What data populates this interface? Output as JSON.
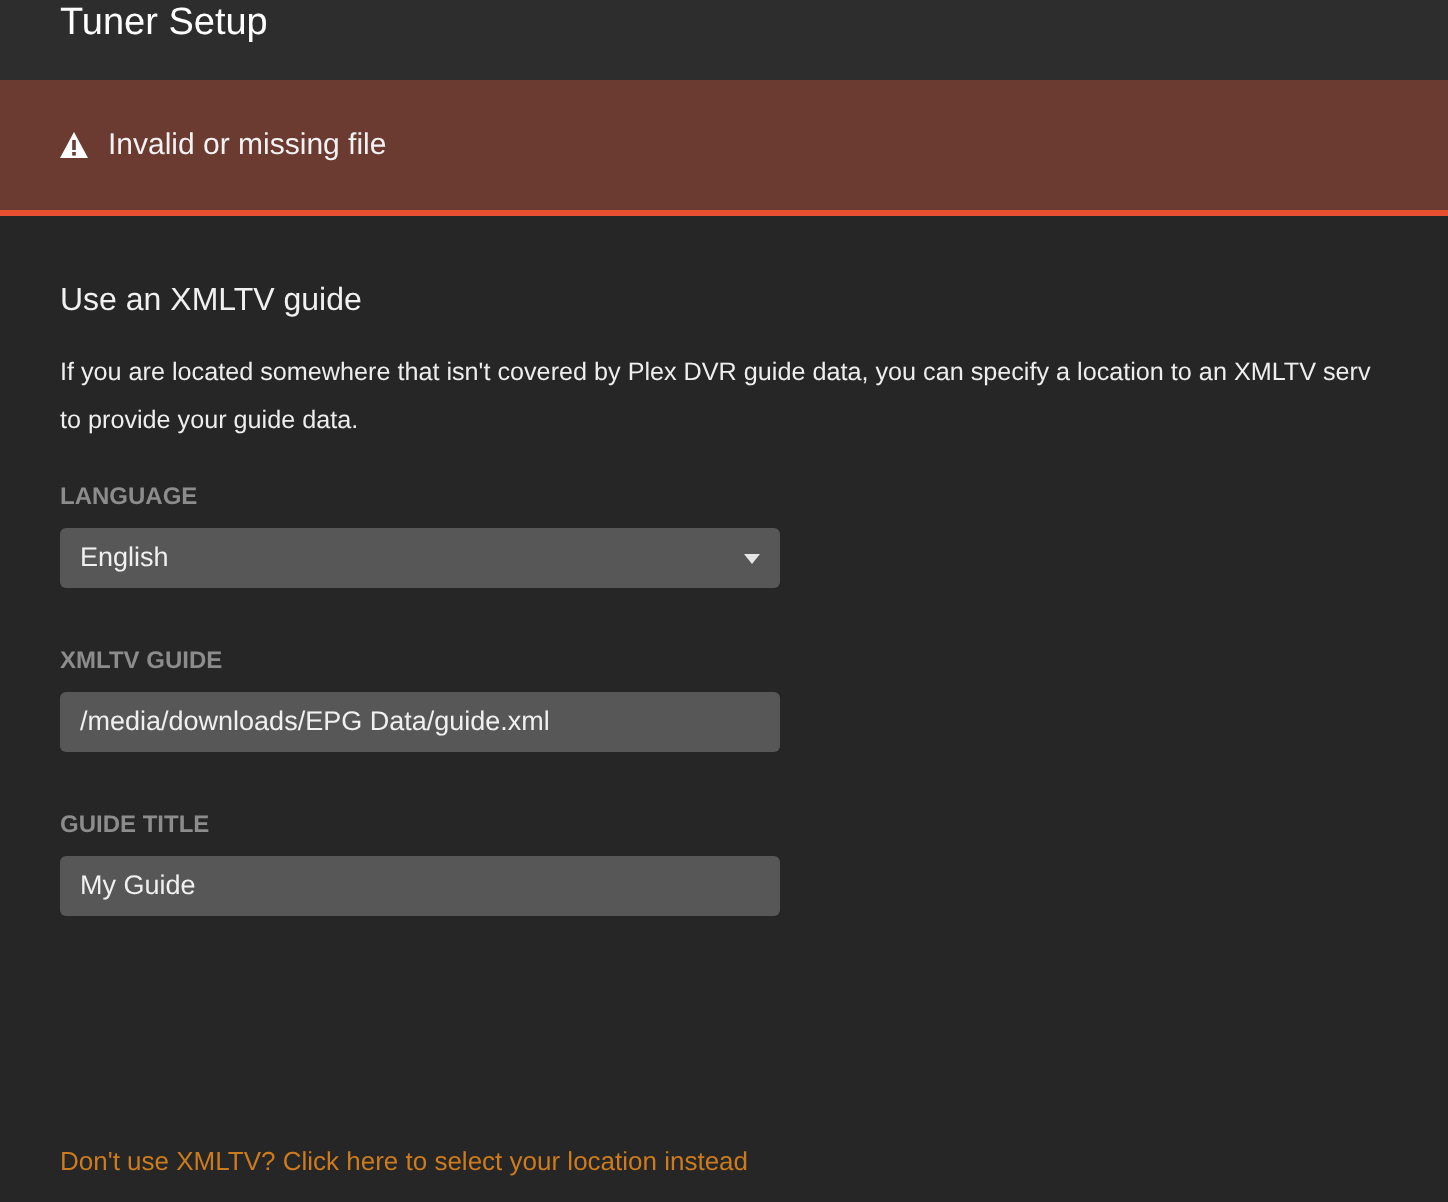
{
  "header": {
    "title": "Tuner Setup"
  },
  "alert": {
    "kind": "error",
    "message": "Invalid or missing file"
  },
  "section": {
    "heading": "Use an XMLTV guide",
    "description_lines": [
      "If you are located somewhere that isn't covered by Plex DVR guide data, you can specify a location to an XMLTV serv",
      "to provide your guide data."
    ]
  },
  "fields": [
    {
      "kind": "select",
      "label": "LANGUAGE",
      "value": "English"
    },
    {
      "kind": "text",
      "label": "XMLTV GUIDE",
      "value": "/media/downloads/EPG Data/guide.xml"
    },
    {
      "kind": "text",
      "label": "GUIDE TITLE",
      "value": "My Guide"
    }
  ],
  "footer_link": {
    "text": "Don't use XMLTV? Click here to select your location instead"
  }
}
